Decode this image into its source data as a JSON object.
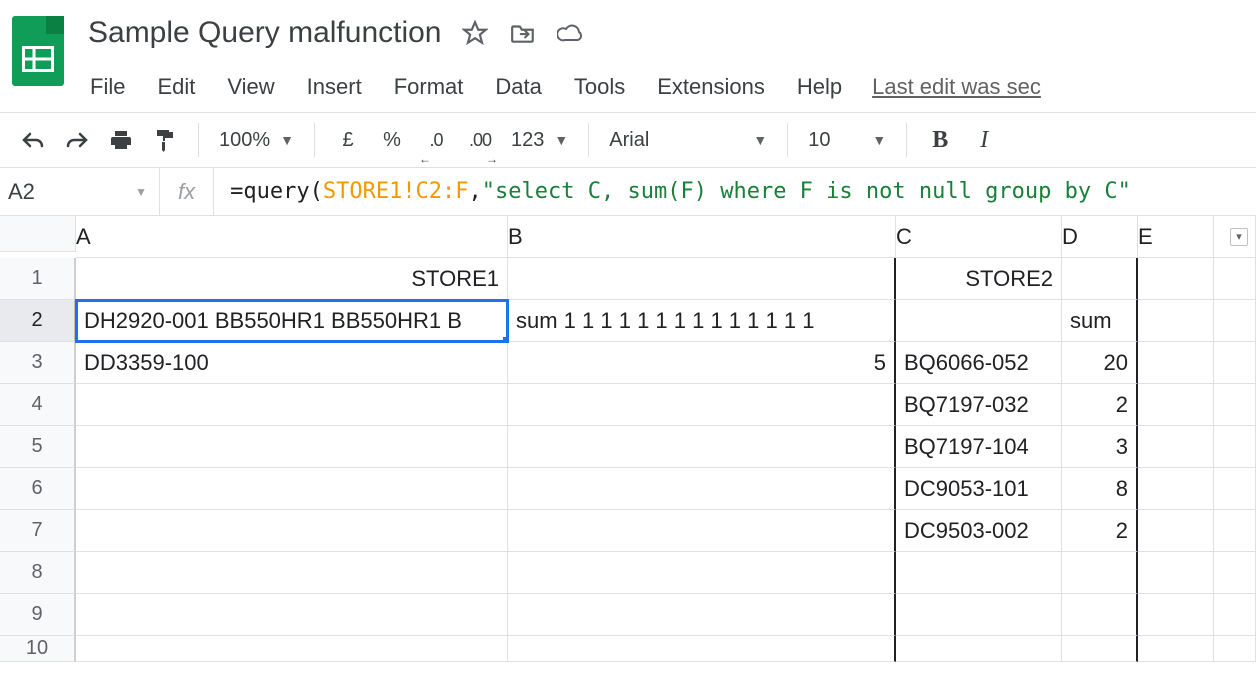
{
  "doc": {
    "title": "Sample Query malfunction"
  },
  "menu": {
    "file": "File",
    "edit": "Edit",
    "view": "View",
    "insert": "Insert",
    "format": "Format",
    "data": "Data",
    "tools": "Tools",
    "extensions": "Extensions",
    "help": "Help",
    "edit_status": "Last edit was sec"
  },
  "toolbar": {
    "zoom": "100%",
    "currency": "£",
    "percent": "%",
    "dec_less": ".0",
    "dec_more": ".00",
    "more_fmt": "123",
    "font": "Arial",
    "font_size": "10",
    "bold": "B",
    "italic": "I"
  },
  "namebox": {
    "value": "A2"
  },
  "formula": {
    "prefix": "=query(",
    "range": "STORE1!C2:F",
    "comma": ",",
    "sql": "\"select C, sum(F) where F is not null group by C\"",
    "full_text": "=query(STORE1!C2:F,\"select C, sum(F) where F is not null group by C\""
  },
  "columns": [
    "A",
    "B",
    "C",
    "D",
    "E",
    ""
  ],
  "rows": {
    "r1": {
      "n": "1",
      "A": "STORE1",
      "B": "",
      "C": "STORE2",
      "D": ""
    },
    "r2": {
      "n": "2",
      "A": "DH2920-001 BB550HR1 BB550HR1 B",
      "B": "sum 1 1 1 1 1 1 1 1 1 1 1 1 1 1",
      "C": "",
      "D": "sum"
    },
    "r3": {
      "n": "3",
      "A": "DD3359-100",
      "B": "5",
      "C": "BQ6066-052",
      "D": "20"
    },
    "r4": {
      "n": "4",
      "A": "",
      "B": "",
      "C": "BQ7197-032",
      "D": "2"
    },
    "r5": {
      "n": "5",
      "A": "",
      "B": "",
      "C": "BQ7197-104",
      "D": "3"
    },
    "r6": {
      "n": "6",
      "A": "",
      "B": "",
      "C": "DC9053-101",
      "D": "8"
    },
    "r7": {
      "n": "7",
      "A": "",
      "B": "",
      "C": "DC9503-002",
      "D": "2"
    },
    "r8": {
      "n": "8"
    },
    "r9": {
      "n": "9"
    },
    "r10": {
      "n": "10"
    }
  }
}
